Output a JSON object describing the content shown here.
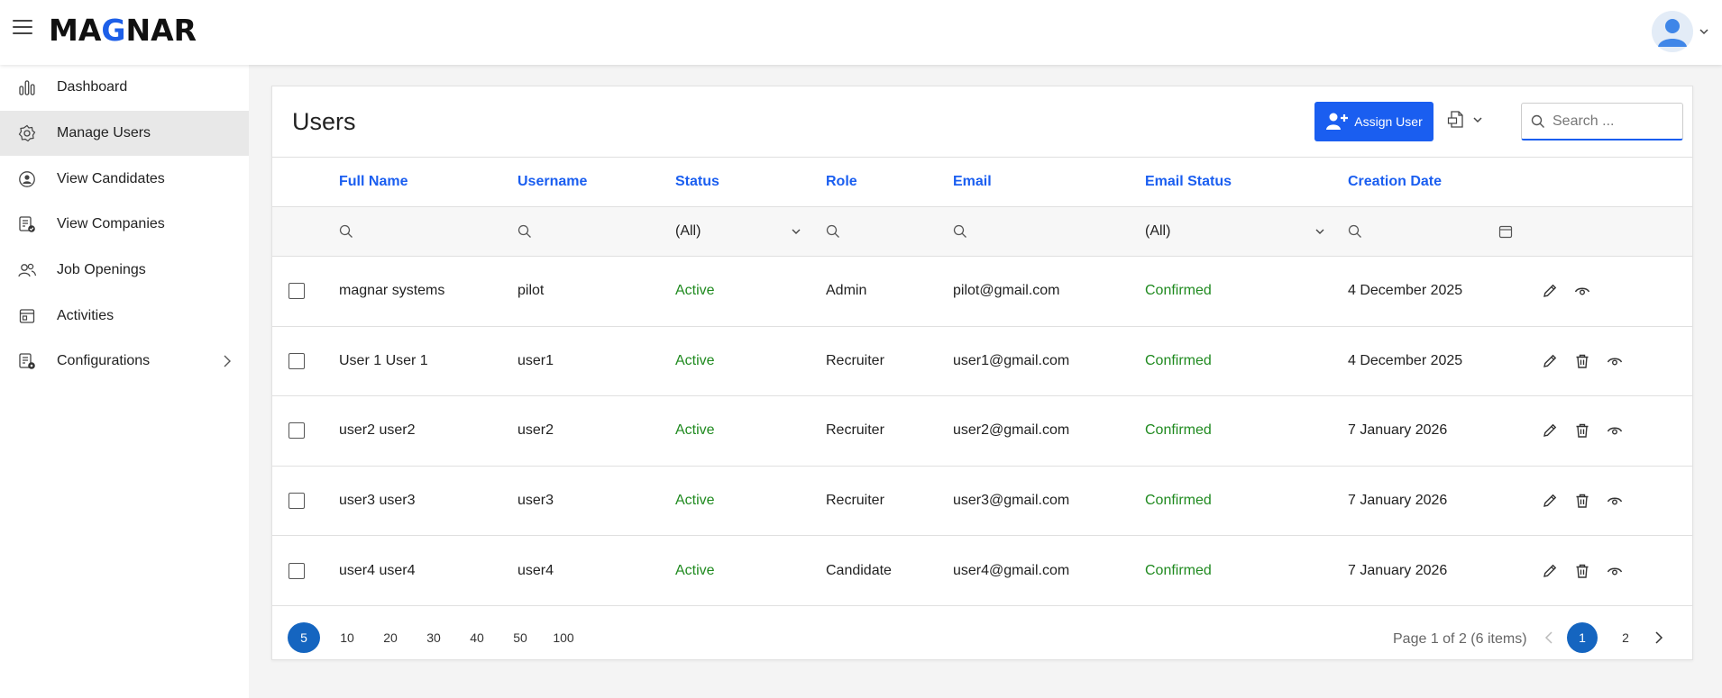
{
  "header": {
    "logo_prefix": "MA",
    "logo_accent": "G",
    "logo_suffix": "NAR",
    "brand_color": "#1d5fe8"
  },
  "sidebar": {
    "items": [
      {
        "label": "Dashboard",
        "icon": "bar-chart-icon"
      },
      {
        "label": "Manage Users",
        "icon": "gear-icon",
        "active": true
      },
      {
        "label": "View Candidates",
        "icon": "user-circle-icon"
      },
      {
        "label": "View Companies",
        "icon": "company-check-icon"
      },
      {
        "label": "Job Openings",
        "icon": "users-icon"
      },
      {
        "label": "Activities",
        "icon": "calendar-activity-icon"
      },
      {
        "label": "Configurations",
        "icon": "config-icon",
        "has_submenu": true
      }
    ]
  },
  "main": {
    "title": "Users",
    "assign_button": "Assign User",
    "search": {
      "placeholder": "Search ..."
    },
    "accent_color": "#1a5ef0",
    "columns": [
      "Full Name",
      "Username",
      "Status",
      "Role",
      "Email",
      "Email Status",
      "Creation Date"
    ],
    "filters": {
      "status": "(All)",
      "email_status": "(All)"
    },
    "rows": [
      {
        "full_name": "magnar systems",
        "username": "pilot",
        "status": "Active",
        "role": "Admin",
        "email": "pilot@gmail.com",
        "email_status": "Confirmed",
        "created": "4 December 2025",
        "can_delete": false
      },
      {
        "full_name": "User 1 User 1",
        "username": "user1",
        "status": "Active",
        "role": "Recruiter",
        "email": "user1@gmail.com",
        "email_status": "Confirmed",
        "created": "4 December 2025",
        "can_delete": true
      },
      {
        "full_name": "user2 user2",
        "username": "user2",
        "status": "Active",
        "role": "Recruiter",
        "email": "user2@gmail.com",
        "email_status": "Confirmed",
        "created": "7 January 2026",
        "can_delete": true
      },
      {
        "full_name": "user3 user3",
        "username": "user3",
        "status": "Active",
        "role": "Recruiter",
        "email": "user3@gmail.com",
        "email_status": "Confirmed",
        "created": "7 January 2026",
        "can_delete": true
      },
      {
        "full_name": "user4 user4",
        "username": "user4",
        "status": "Active",
        "role": "Candidate",
        "email": "user4@gmail.com",
        "email_status": "Confirmed",
        "created": "7 January 2026",
        "can_delete": true
      }
    ],
    "status_color": "#1f8a1f"
  },
  "pagination": {
    "page_sizes": [
      "5",
      "10",
      "20",
      "30",
      "40",
      "50",
      "100"
    ],
    "selected_size": "5",
    "info": "Page 1 of 2 (6 items)",
    "pages": [
      "1",
      "2"
    ],
    "current_page": "1",
    "active_color": "#1565c0"
  }
}
